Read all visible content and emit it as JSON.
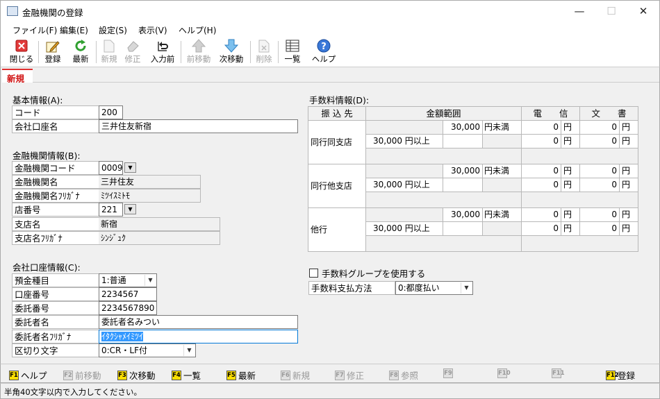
{
  "window": {
    "title": "金融機関の登録",
    "minimize": "—",
    "maximize": "☐",
    "close": "✕"
  },
  "menu": [
    "ファイル(F)",
    "編集(E)",
    "設定(S)",
    "表示(V)",
    "ヘルプ(H)"
  ],
  "toolbar": {
    "close": "閉じる",
    "register": "登録",
    "refresh": "最新",
    "new": "新規",
    "edit": "修正",
    "input_prev": "入力前",
    "prev_move": "前移動",
    "next_move": "次移動",
    "delete": "削除",
    "list": "一覧",
    "help": "ヘルプ"
  },
  "mode_tab": "新規",
  "basic": {
    "heading": "基本情報(A):",
    "code_label": "コード",
    "code_value": "200",
    "account_label": "会社口座名",
    "account_value": "三井住友新宿"
  },
  "bank": {
    "heading": "金融機関情報(B):",
    "bank_code_label": "金融機関コード",
    "bank_code_value": "0009",
    "bank_name_label": "金融機関名",
    "bank_name_value": "三井住友",
    "bank_kana_label": "金融機関名ﾌﾘｶﾞﾅ",
    "bank_kana_value": "ﾐﾂｲｽﾐﾄﾓ",
    "branch_no_label": "店番号",
    "branch_no_value": "221",
    "branch_name_label": "支店名",
    "branch_name_value": "新宿",
    "branch_kana_label": "支店名ﾌﾘｶﾞﾅ",
    "branch_kana_value": "ｼﾝｼﾞｭｸ"
  },
  "account": {
    "heading": "会社口座情報(C):",
    "type_label": "預金種目",
    "type_value": "1:普通",
    "number_label": "口座番号",
    "number_value": "2234567",
    "consign_no_label": "委託番号",
    "consign_no_value": "2234567890",
    "consign_name_label": "委託者名",
    "consign_name_value": "委託者名みつい",
    "consign_kana_label": "委託者名ﾌﾘｶﾞﾅ",
    "consign_kana_value": "ｲﾀｸｼｬﾒｲﾐﾂｲ",
    "delim_label": "区切り文字",
    "delim_value": "0:CR・LF付"
  },
  "fees": {
    "heading": "手数料情報(D):",
    "col_transfer": "振 込 先",
    "col_range": "金額範囲",
    "col_wire": "電　　信",
    "col_doc": "文　　書",
    "rows": [
      {
        "name": "同行同支店",
        "upper": "30,000",
        "upper_unit": "円未満",
        "lower": "30,000 円以上",
        "wire1": "0",
        "doc1": "0",
        "wire2": "0",
        "doc2": "0"
      },
      {
        "name": "同行他支店",
        "upper": "30,000",
        "upper_unit": "円未満",
        "lower": "30,000 円以上",
        "wire1": "0",
        "doc1": "0",
        "wire2": "0",
        "doc2": "0"
      },
      {
        "name": "他行",
        "upper": "30,000",
        "upper_unit": "円未満",
        "lower": "30,000 円以上",
        "wire1": "0",
        "doc1": "0",
        "wire2": "0",
        "doc2": "0"
      }
    ],
    "yen": "円",
    "group_checkbox": "手数料グループを使用する",
    "method_label": "手数料支払方法",
    "method_value": "0:都度払い"
  },
  "fkeys": [
    {
      "key": "F1",
      "label": "ヘルプ",
      "enabled": true
    },
    {
      "key": "F2",
      "label": "前移動",
      "enabled": false
    },
    {
      "key": "F3",
      "label": "次移動",
      "enabled": true
    },
    {
      "key": "F4",
      "label": "一覧",
      "enabled": true
    },
    {
      "key": "F5",
      "label": "最新",
      "enabled": true
    },
    {
      "key": "F6",
      "label": "新規",
      "enabled": false
    },
    {
      "key": "F7",
      "label": "修正",
      "enabled": false
    },
    {
      "key": "F8",
      "label": "参照",
      "enabled": false
    },
    {
      "key": "F9",
      "label": "",
      "enabled": false
    },
    {
      "key": "F10",
      "label": "",
      "enabled": false
    },
    {
      "key": "F11",
      "label": "",
      "enabled": false
    },
    {
      "key": "F12",
      "label": "登録",
      "enabled": true
    }
  ],
  "status": "半角40文字以内で入力してください。"
}
